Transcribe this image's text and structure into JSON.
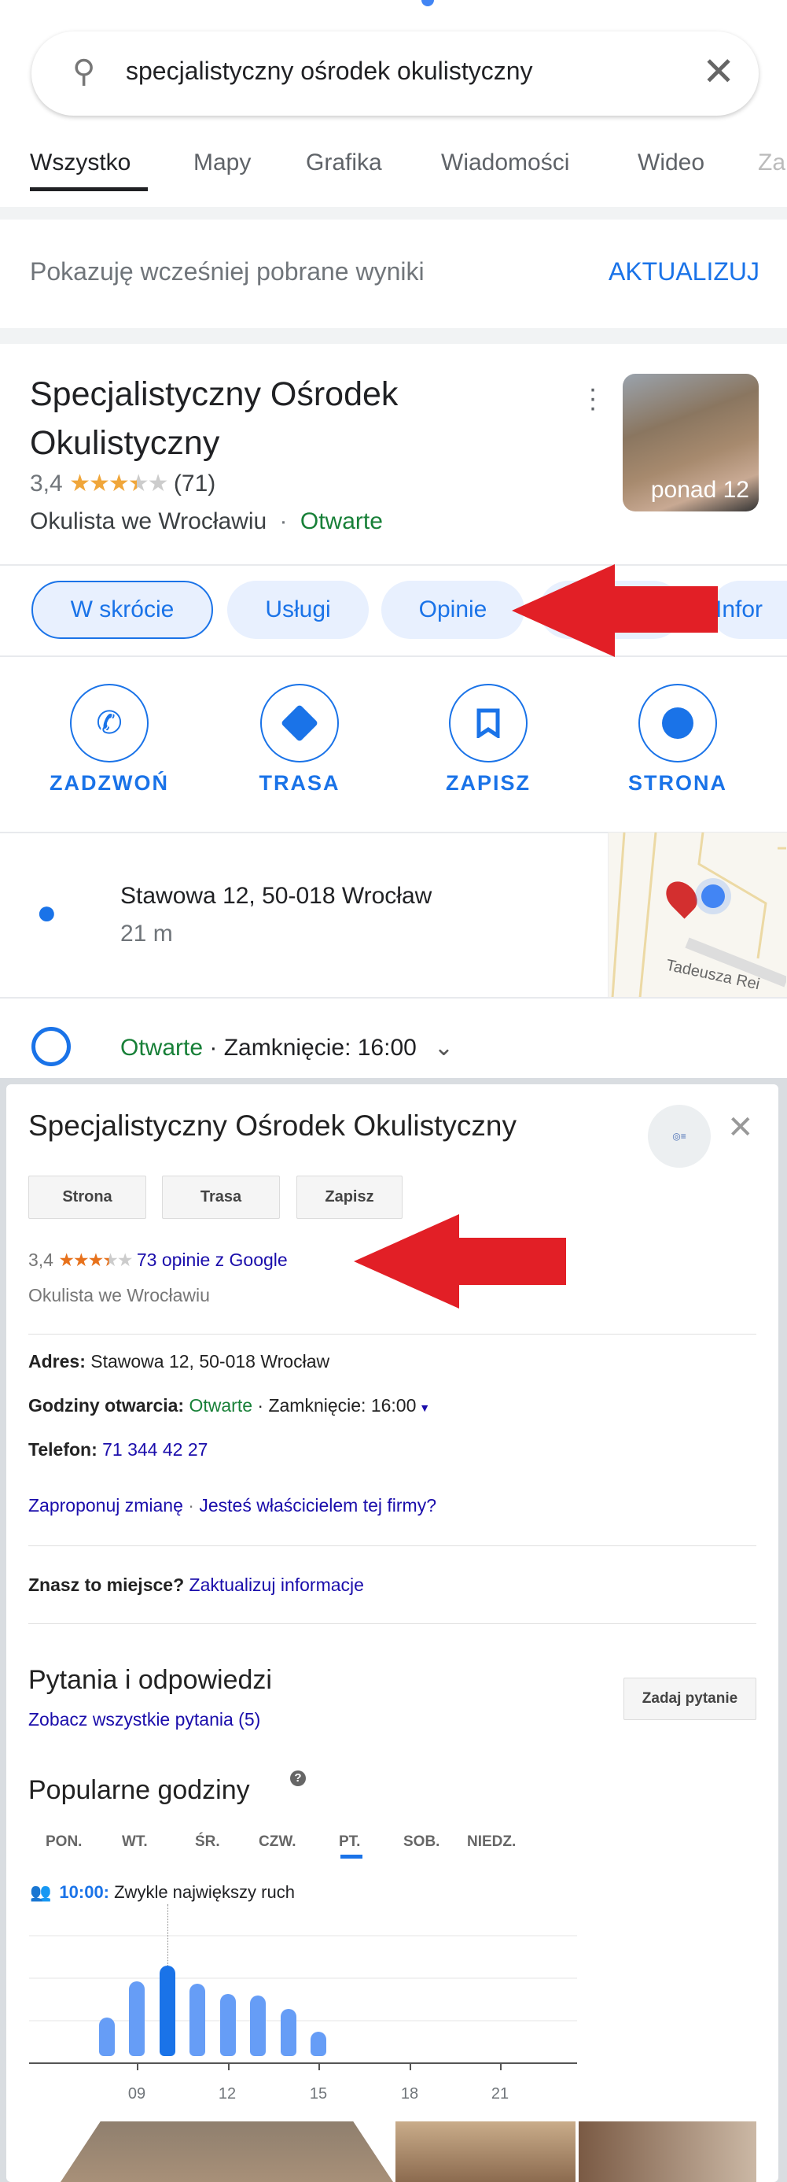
{
  "search": {
    "query": "specjalistyczny ośrodek okulistyczny",
    "icon": "search-icon",
    "clear_icon": "close-icon"
  },
  "tabs": [
    {
      "label": "Wszystko",
      "active": true
    },
    {
      "label": "Mapy"
    },
    {
      "label": "Grafika"
    },
    {
      "label": "Wiadomości"
    },
    {
      "label": "Wideo"
    },
    {
      "label": "Za"
    }
  ],
  "notice": {
    "text": "Pokazuję wcześniej pobrane wyniki",
    "action": "AKTUALIZUJ"
  },
  "business": {
    "name": "Specjalistyczny Ośrodek Okulistyczny",
    "rating": "3,4",
    "rating_value": 3.4,
    "review_count": "(71)",
    "category": "Okulista we Wrocławiu",
    "separator": "·",
    "status": "Otwarte",
    "photos_label": "ponad 12"
  },
  "chips": [
    {
      "label": "W skrócie",
      "selected": true
    },
    {
      "label": "Usługi"
    },
    {
      "label": "Opinie"
    },
    {
      "label": ""
    },
    {
      "label": "Infor"
    }
  ],
  "actions": [
    {
      "label": "ZADZWOŃ",
      "icon": "phone-icon"
    },
    {
      "label": "TRASA",
      "icon": "directions-icon"
    },
    {
      "label": "ZAPISZ",
      "icon": "bookmark-icon"
    },
    {
      "label": "STRONA",
      "icon": "globe-icon"
    }
  ],
  "address": {
    "text": "Stawowa 12, 50-018 Wrocław",
    "distance": "21 m",
    "map_street": "Tadeusza Rei"
  },
  "hours": {
    "status": "Otwarte",
    "closing": " · Zamknięcie: 16:00"
  },
  "panel": {
    "title": "Specjalistyczny Ośrodek Okulistyczny",
    "buttons": [
      "Strona",
      "Trasa",
      "Zapisz"
    ],
    "rating": "3,4",
    "reviews_link": "73 opinie z Google",
    "category": "Okulista we Wrocławiu",
    "address_label": "Adres:",
    "address": "Stawowa 12, 50-018 Wrocław",
    "hours_label": "Godziny otwarcia:",
    "hours_status": "Otwarte",
    "hours_closing": "· Zamknięcie: 16:00",
    "phone_label": "Telefon:",
    "phone": "71 344 42 27",
    "suggest_edit": "Zaproponuj zmianę",
    "sep": "·",
    "owner_link": "Jesteś właścicielem tej firmy?",
    "know_label": "Znasz to miejsce?",
    "update_link": "Zaktualizuj informacje",
    "qa_title": "Pytania i odpowiedzi",
    "qa_link": "Zobacz wszystkie pytania (5)",
    "ask_button": "Zadaj pytanie",
    "popular_title": "Popularne godziny",
    "help_icon": "?",
    "days": [
      "PON.",
      "WT.",
      "ŚR.",
      "CZW.",
      "PT.",
      "SOB.",
      "NIEDZ."
    ],
    "active_day": "PT.",
    "peak_time": "10:00:",
    "peak_text": " Zwykle największy ruch"
  },
  "chart_data": {
    "type": "bar",
    "x": [
      8,
      9,
      10,
      11,
      12,
      13,
      14,
      15
    ],
    "values": [
      32,
      62,
      75,
      60,
      51,
      50,
      39,
      20
    ],
    "highlight": 10,
    "tick_labels": [
      "09",
      "12",
      "15",
      "18",
      "21"
    ],
    "ylim": [
      0,
      100
    ],
    "colors": {
      "bar": "#669df6",
      "highlight": "#1a73e8"
    }
  },
  "annotations": {
    "arrow_color": "#e21f26"
  }
}
